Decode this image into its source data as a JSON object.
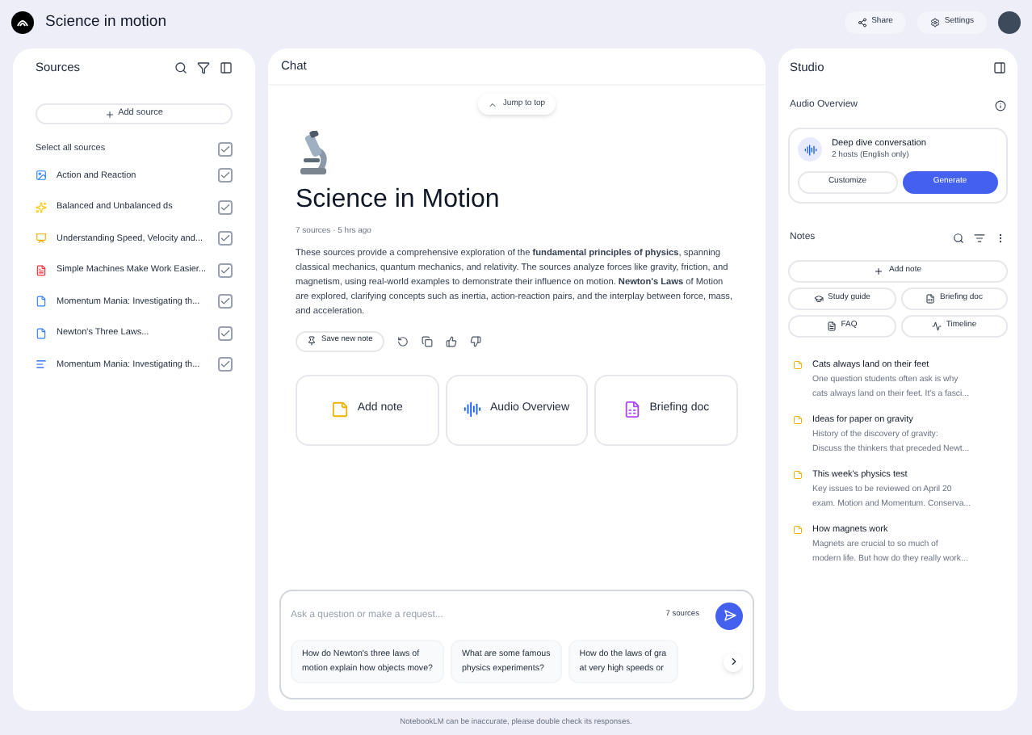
{
  "header": {
    "title": "Science in motion",
    "share": "Share",
    "settings": "Settings"
  },
  "sources": {
    "title": "Sources",
    "add": "Add source",
    "select_all": {
      "label": "Select all sources",
      "checked": true
    },
    "items": [
      {
        "kind": "image",
        "title": "Action and Reaction",
        "checked": true
      },
      {
        "kind": "sparkle",
        "title": "Balanced and Unbalanced ds",
        "checked": true
      },
      {
        "kind": "slides",
        "title": "Understanding Speed, Velocity and...",
        "checked": true
      },
      {
        "kind": "pdf",
        "title": "Simple Machines Make Work Easier...",
        "checked": true
      },
      {
        "kind": "doc",
        "title": "Momentum Mania: Investigating th...",
        "checked": true
      },
      {
        "kind": "doc",
        "title": "Newton's Three Laws...",
        "checked": true
      },
      {
        "kind": "text",
        "title": "Momentum Mania: Investigating th...",
        "checked": true
      }
    ]
  },
  "chat": {
    "title": "Chat",
    "jump": "Jump to top",
    "notebook_title": "Science in Motion",
    "meta": "7 sources · 5 hrs ago",
    "summary": "These sources provide a comprehensive exploration of the **fundamental principles of physics**, spanning classical mechanics, quantum mechanics, and relativity. The sources analyze forces like gravity, friction, and magnetism, using real-world examples to demonstrate their influence on motion. **Newton's Laws** of Motion are explored, clarifying concepts such as inertia, action-reaction pairs, and the interplay between force, mass, and acceleration.",
    "save_note": "Save new note",
    "cards": [
      {
        "kind": "note",
        "label": "Add note"
      },
      {
        "kind": "audio",
        "label": "Audio Overview"
      },
      {
        "kind": "briefing",
        "label": "Briefing doc"
      }
    ],
    "input": {
      "placeholder": "Ask a question or make a request...",
      "sources": "7 sources"
    },
    "suggestions": [
      {
        "lines": [
          "How do Newton's three laws of",
          "motion explain how objects move?"
        ]
      },
      {
        "lines": [
          "What are some famous",
          "physics experiments?"
        ]
      },
      {
        "lines": [
          "How do the laws of gra",
          "at very high speeds or"
        ]
      }
    ],
    "disclaimer": "NotebookLM can be inaccurate, please double check its responses."
  },
  "studio": {
    "title": "Studio",
    "audio_title": "Audio Overview",
    "deep_dive": "Deep dive conversation",
    "hosts": "2 hosts (English only)",
    "customize": "Customize",
    "generate": "Generate",
    "notes_title": "Notes",
    "add_note": "Add note",
    "tools": [
      {
        "kind": "study",
        "label": "Study guide"
      },
      {
        "kind": "briefing",
        "label": "Briefing doc"
      },
      {
        "kind": "faq",
        "label": "FAQ"
      },
      {
        "kind": "timeline",
        "label": "Timeline"
      }
    ],
    "notes": [
      {
        "title": "Cats always land on their feet",
        "preview": [
          "One question students often ask is why",
          "cats always land on their feet. It's a fasci..."
        ]
      },
      {
        "title": "Ideas for paper on gravity",
        "preview": [
          "History of the discovery of gravity:",
          "Discuss the thinkers that preceded Newt..."
        ]
      },
      {
        "title": "This week's physics test",
        "preview": [
          "Key issues to be reviewed on April 20",
          "exam. Motion and Momentum. Conserva..."
        ]
      },
      {
        "title": "How magnets work",
        "preview": [
          "Magnets are crucial to so much of",
          "modern life. But how do they really work..."
        ]
      }
    ]
  }
}
